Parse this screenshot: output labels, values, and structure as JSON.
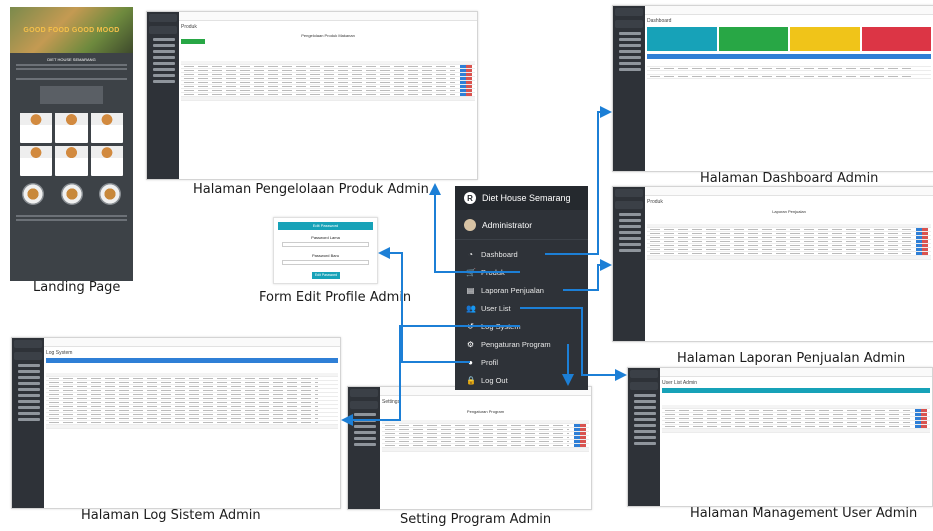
{
  "captions": {
    "landing": "Landing Page",
    "produk": "Halaman Pengelolaan Produk Admin",
    "dashboard": "Halaman Dashboard Admin",
    "form_profile": "Form Edit Profile Admin",
    "laporan": "Halaman Laporan Penjualan Admin",
    "log": "Halaman Log Sistem Admin",
    "setting": "Setting Program Admin",
    "user": "Halaman Management User Admin"
  },
  "menu": {
    "brand": "Diet House Semarang",
    "user": "Administrator",
    "items": [
      {
        "label": "Dashboard",
        "icon": "dashboard-icon",
        "glyph": "◔"
      },
      {
        "label": "Produk",
        "icon": "cart-icon",
        "glyph": "🛒"
      },
      {
        "label": "Laporan Penjualan",
        "icon": "chart-icon",
        "glyph": "▤"
      },
      {
        "label": "User List",
        "icon": "users-icon",
        "glyph": "👥"
      },
      {
        "label": "Log System",
        "icon": "history-icon",
        "glyph": "↺"
      },
      {
        "label": "Pengaturan Program",
        "icon": "gears-icon",
        "glyph": "⚙"
      },
      {
        "label": "Profil",
        "icon": "profile-icon",
        "glyph": "●"
      },
      {
        "label": "Log Out",
        "icon": "lock-icon",
        "glyph": "🔒"
      }
    ]
  },
  "screens": {
    "produk_title": "Produk",
    "produk_heading": "Pengelolaan Produk Makanan",
    "dashboard_title": "Dashboard",
    "laporan_title": "Produk",
    "laporan_heading": "Laporan Penjualan",
    "log_title": "Log System",
    "setting_title": "Settings",
    "setting_heading": "Pengaturan Program",
    "user_title": "User List Admin",
    "form_header": "Edit Password",
    "form_field1": "Password Lama",
    "form_field2": "Password Baru",
    "form_button": "Edit Password",
    "landing_hero": "GOOD FOOD GOOD MOOD",
    "landing_section": "DIET HOUSE SEMARANG"
  },
  "colors": {
    "menu_bg": "#2e3238",
    "arrow": "#1c7fd6",
    "dash_teal": "#17a2b8",
    "dash_green": "#28a745",
    "dash_yellow": "#f0c419",
    "dash_red": "#dc3545"
  }
}
